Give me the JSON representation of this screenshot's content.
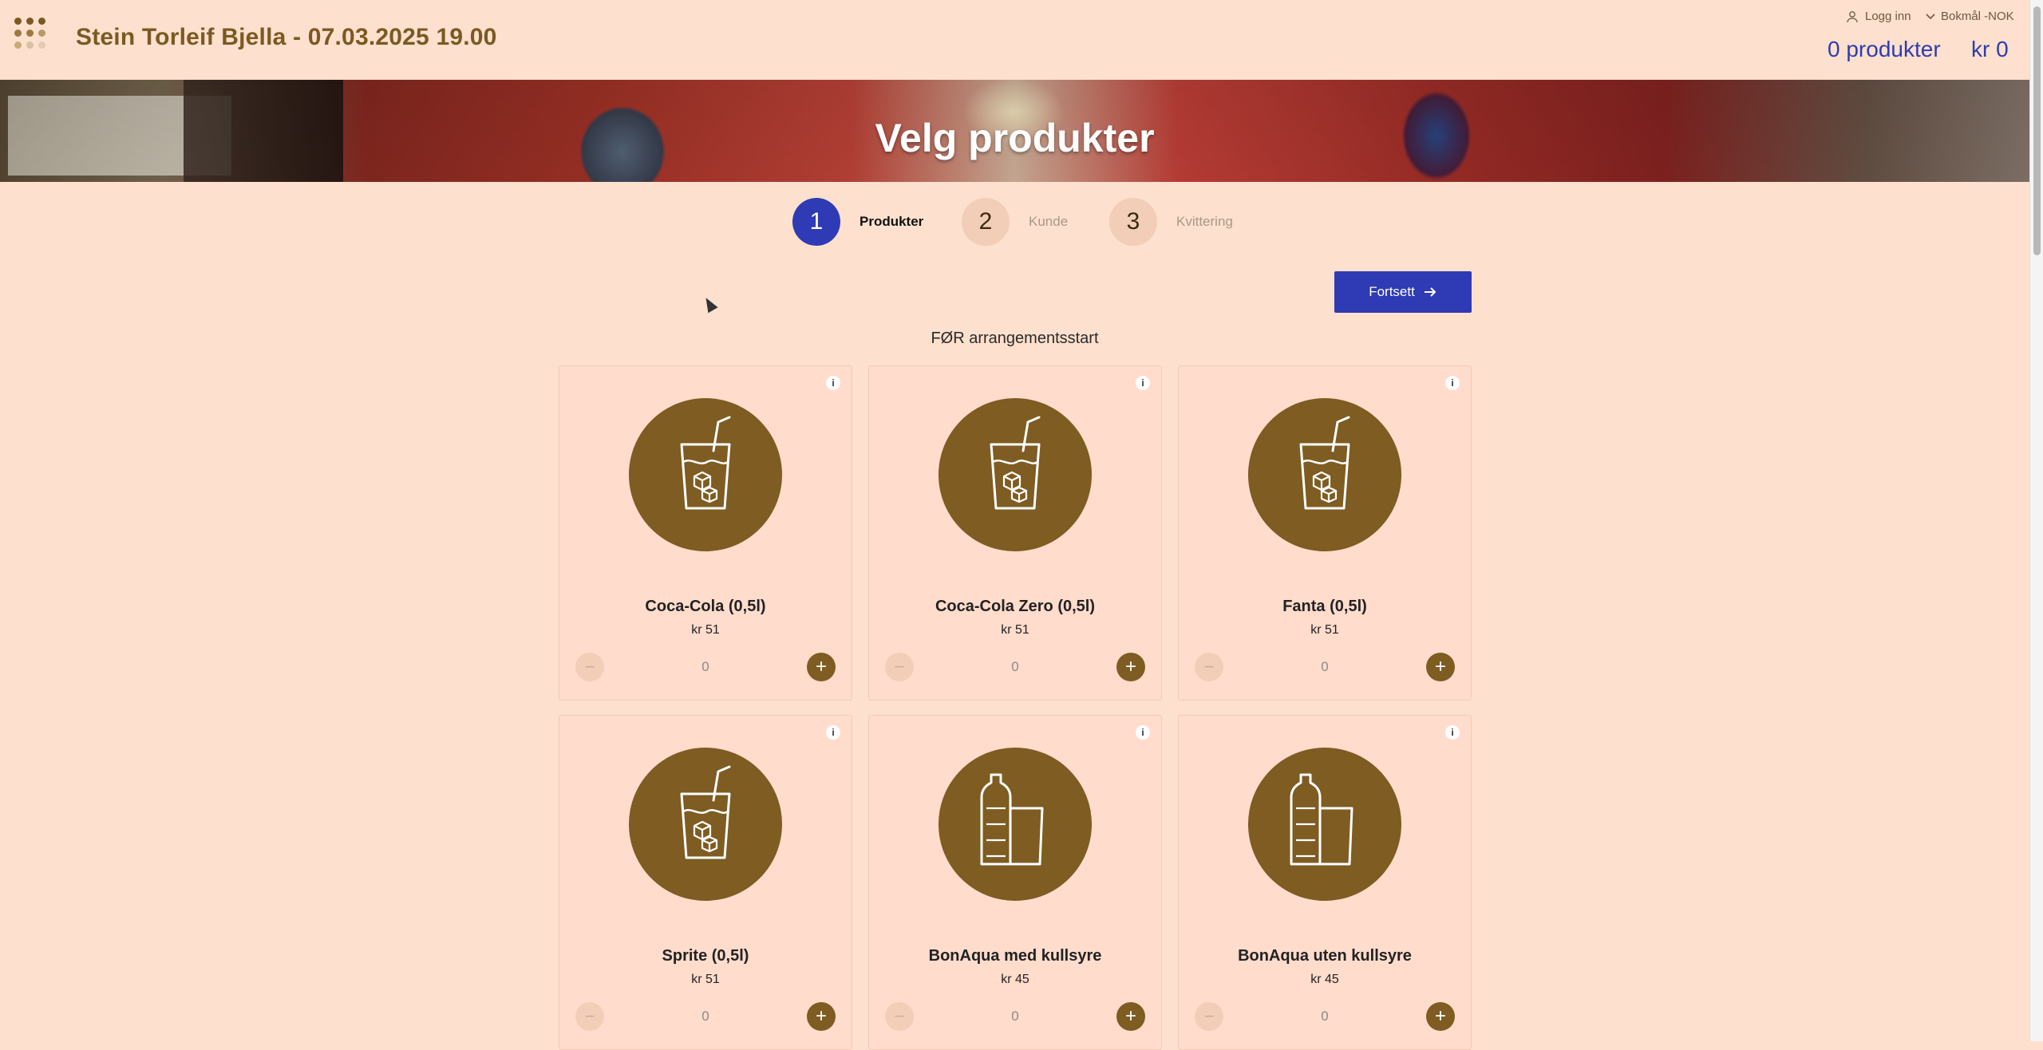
{
  "header": {
    "title": "Stein Torleif Bjella - 07.03.2025 19.00",
    "login_label": "Logg inn",
    "language_label": "Bokmål -NOK",
    "cart_count": "0 produkter",
    "cart_total": "kr 0"
  },
  "banner": {
    "title": "Velg produkter"
  },
  "steps": [
    {
      "number": "1",
      "label": "Produkter",
      "state": "active"
    },
    {
      "number": "2",
      "label": "Kunde",
      "state": "inactive"
    },
    {
      "number": "3",
      "label": "Kvittering",
      "state": "inactive"
    }
  ],
  "continue_label": "Fortsett",
  "section_title": "FØR arrangementsstart",
  "products": [
    {
      "name": "Coca-Cola (0,5l)",
      "price": "kr 51",
      "qty": "0",
      "icon": "glass-icon"
    },
    {
      "name": "Coca-Cola Zero (0,5l)",
      "price": "kr 51",
      "qty": "0",
      "icon": "glass-icon"
    },
    {
      "name": "Fanta (0,5l)",
      "price": "kr 51",
      "qty": "0",
      "icon": "glass-icon"
    },
    {
      "name": "Sprite (0,5l)",
      "price": "kr 51",
      "qty": "0",
      "icon": "glass-icon"
    },
    {
      "name": "BonAqua med kullsyre",
      "price": "kr 45",
      "qty": "0",
      "icon": "bottle-icon"
    },
    {
      "name": "BonAqua uten kullsyre",
      "price": "kr 45",
      "qty": "0",
      "icon": "bottle-icon"
    }
  ],
  "colors": {
    "accent_blue": "#2e3bb5",
    "brand_brown": "#7e5c22",
    "background": "#fde0cd"
  }
}
